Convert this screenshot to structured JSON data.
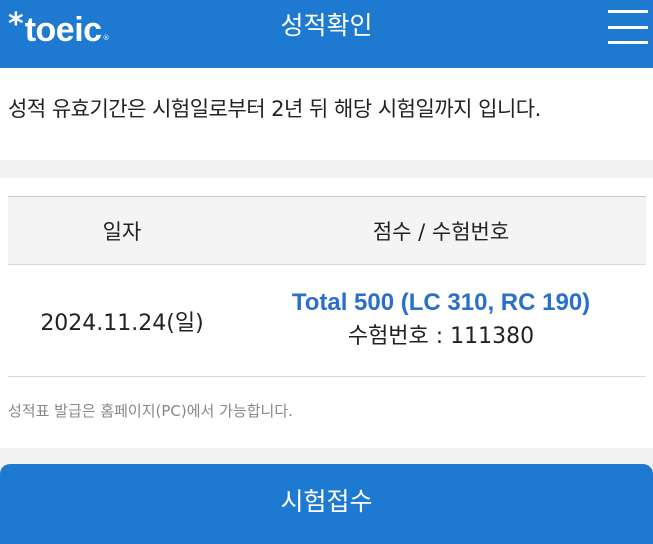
{
  "header": {
    "logo_star": "*",
    "logo_text": "toeic",
    "logo_reg": "®",
    "title": "성적확인",
    "menu_icon": "hamburger-menu-icon"
  },
  "notice": {
    "text": "성적 유효기간은 시험일로부터 2년 뒤 해당 시험일까지 입니다."
  },
  "table": {
    "headers": [
      "일자",
      "점수 / 수험번호"
    ],
    "rows": [
      {
        "date": "2024.11.24(일)",
        "score": "Total 500 (LC 310, RC 190)",
        "exam_number": "수험번호 : 111380"
      }
    ]
  },
  "footnote": "성적표 발급은 홈페이지(PC)에서 가능합니다.",
  "apply_button": "시험접수",
  "colors": {
    "brand_blue": "#1e7ad1",
    "score_blue": "#2a6fc9"
  }
}
